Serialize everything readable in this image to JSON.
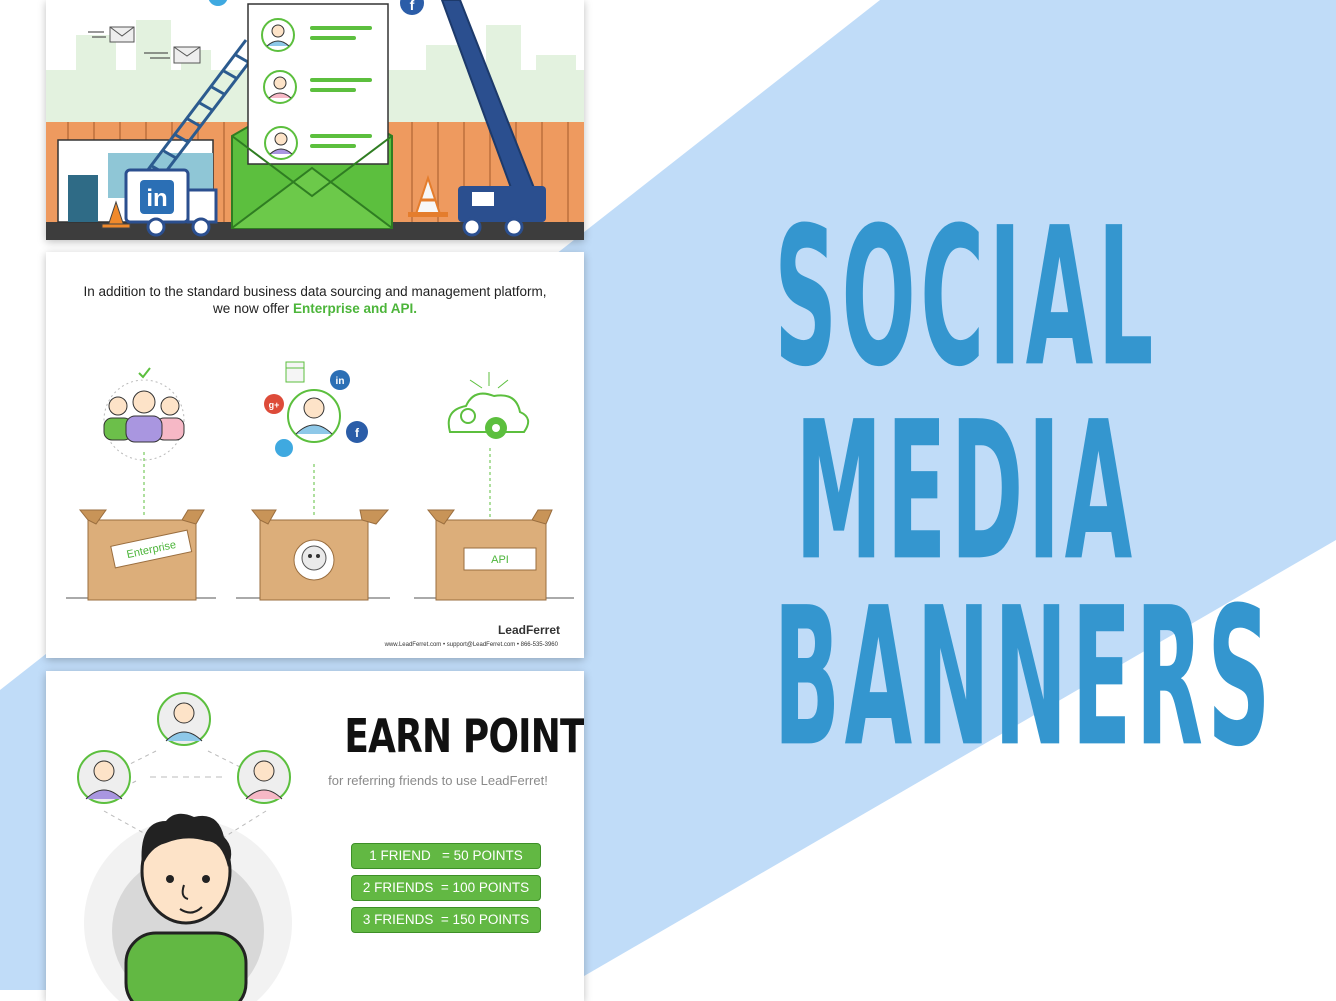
{
  "headline": {
    "line1": "SOCIAL",
    "line2": "MEDIA",
    "line3": "BANNERS"
  },
  "colors": {
    "headline": "#3496cf",
    "stripe": "#c0dcf8",
    "green": "#62b843",
    "navy": "#2b4f8f"
  },
  "banner2": {
    "intro_line1": "In addition to the standard business data sourcing and management platform,",
    "intro_line2_prefix": "we now offer ",
    "intro_line2_highlight": "Enterprise and API.",
    "box_labels": [
      "Enterprise",
      "API"
    ],
    "brand": "LeadFerret",
    "contact": "www.LeadFerret.com • support@LeadFerret.com • 866-535-3960"
  },
  "banner3": {
    "title": "EARN POINTS",
    "subtitle": "for referring friends to use LeadFerret!",
    "rewards": [
      "1 FRIEND   = 50 POINTS",
      "2 FRIENDS  = 100 POINTS",
      "3 FRIENDS  = 150 POINTS"
    ]
  },
  "icons": [
    "linkedin-icon",
    "facebook-icon",
    "twitter-icon",
    "google-plus-icon",
    "calendar-icon",
    "cloud-gear-icon",
    "mail-icon",
    "traffic-cone-icon",
    "crane-truck-icon",
    "ferret-logo-icon"
  ]
}
